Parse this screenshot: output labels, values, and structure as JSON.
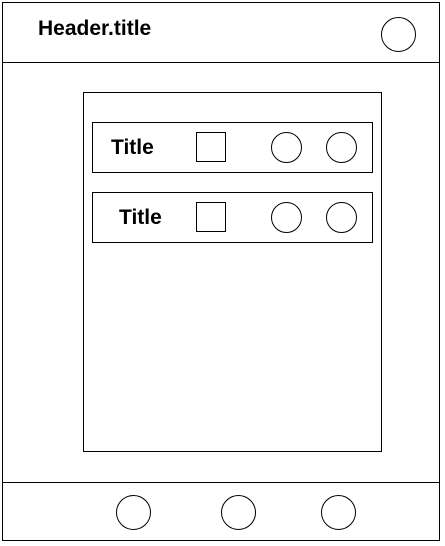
{
  "header": {
    "title": "Header.title"
  },
  "list": {
    "rows": [
      {
        "title": "Title"
      },
      {
        "title": "Title"
      }
    ]
  },
  "icons": {
    "header_action": "circle-icon",
    "row_thumbnail": "square-icon",
    "row_action": "circle-icon",
    "footer_nav": "circle-icon"
  }
}
